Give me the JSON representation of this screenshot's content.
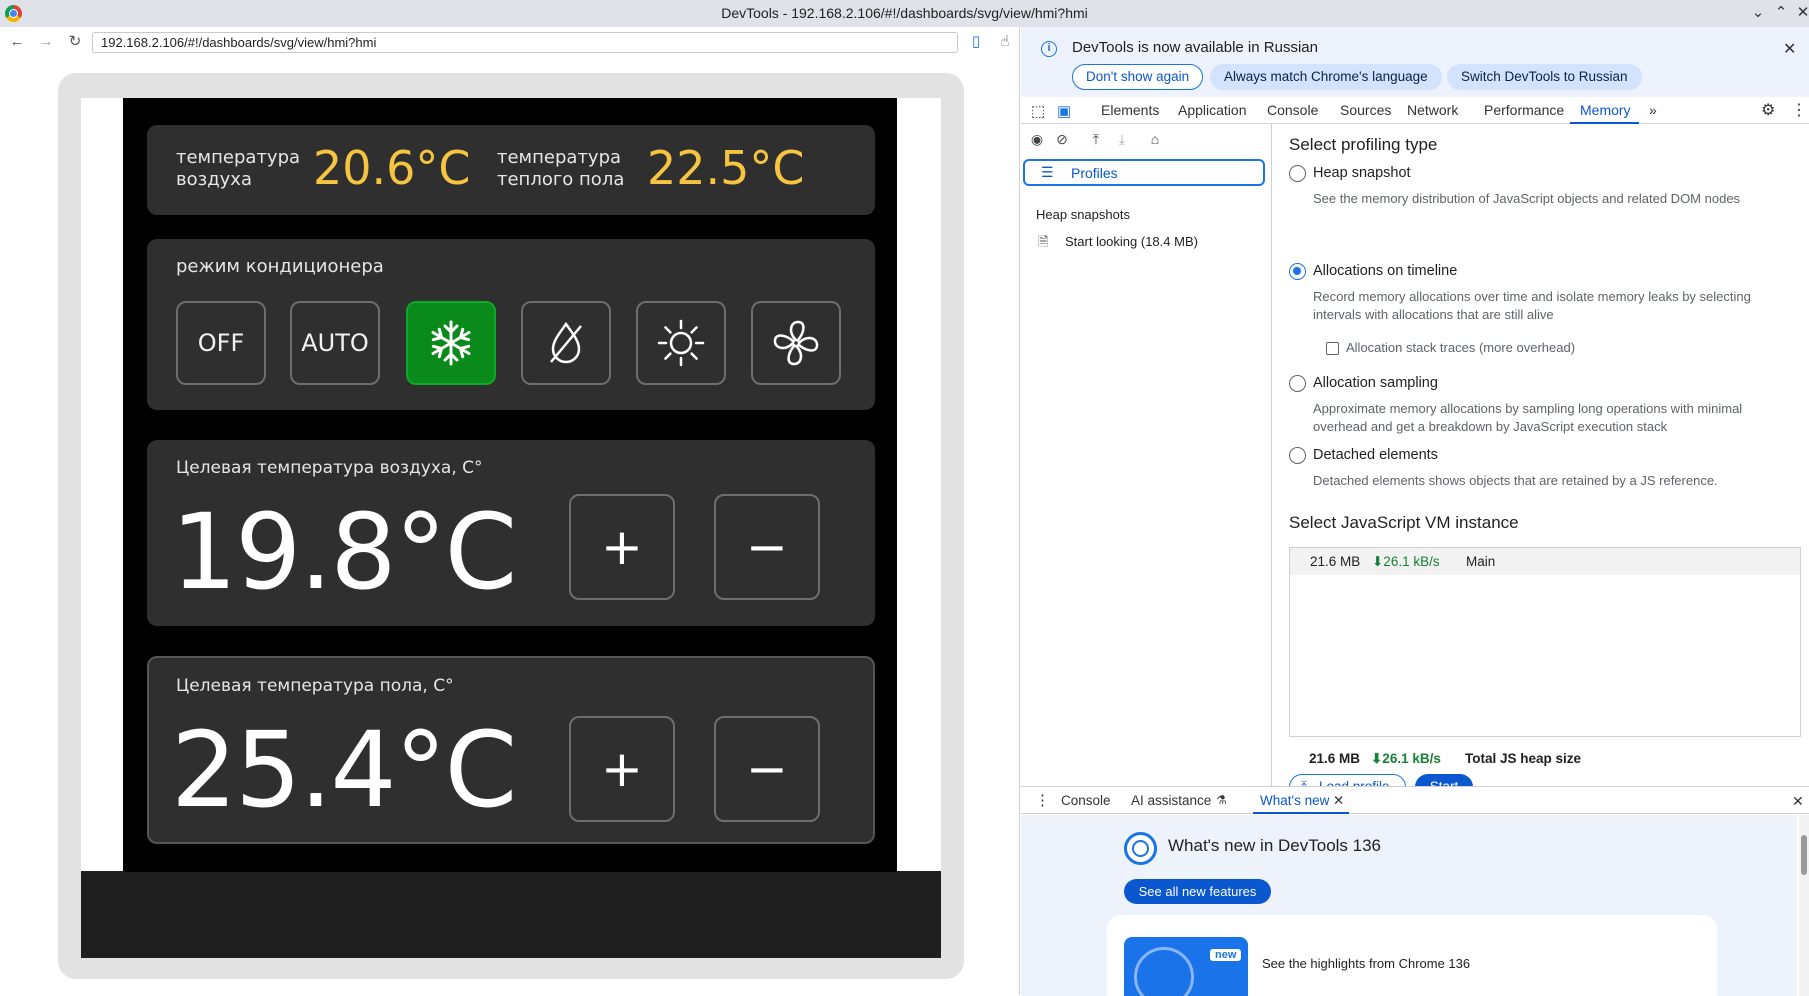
{
  "window": {
    "title": "DevTools - 192.168.2.106/#!/dashboards/svg/view/hmi?hmi"
  },
  "browser": {
    "url": "192.168.2.106/#!/dashboards/svg/view/hmi?hmi"
  },
  "hmi": {
    "air_temp_label_1": "температура",
    "air_temp_label_2": "воздуха",
    "air_temp_value": "20.6°C",
    "floor_temp_label_1": "температура",
    "floor_temp_label_2": "теплого пола",
    "floor_temp_value": "22.5°C",
    "ac_mode_title": "режим кондиционера",
    "modes": {
      "off": "OFF",
      "auto": "AUTO"
    },
    "active_mode": "cool",
    "target_air_title": "Целевая температура воздуха, C°",
    "target_air_value": "19.8°C",
    "target_floor_title": "Целевая температура пола, C°",
    "target_floor_value": "25.4°C",
    "plus": "+",
    "minus": "−"
  },
  "devtools": {
    "infobar": {
      "message": "DevTools is now available in Russian",
      "dont_show": "Don't show again",
      "match_lang": "Always match Chrome's language",
      "switch_lang": "Switch DevTools to Russian"
    },
    "tabs": [
      "Elements",
      "Application",
      "Console",
      "Sources",
      "Network",
      "Performance",
      "Memory"
    ],
    "active_tab": "Memory",
    "sidebar": {
      "profiles": "Profiles",
      "heap_snapshots_heading": "Heap snapshots",
      "snapshot_item": "Start looking (18.4 MB)"
    },
    "profiling": {
      "title": "Select profiling type",
      "options": [
        {
          "label": "Heap snapshot",
          "desc": "See the memory distribution of JavaScript objects and related DOM nodes",
          "selected": false
        },
        {
          "label": "Allocations on timeline",
          "desc": "Record memory allocations over time and isolate memory leaks by selecting intervals with allocations that are still alive",
          "selected": true
        },
        {
          "label": "Allocation sampling",
          "desc": "Approximate memory allocations by sampling long operations with minimal overhead and get a breakdown by JavaScript execution stack",
          "selected": false
        },
        {
          "label": "Detached elements",
          "desc": "Detached elements shows objects that are retained by a JS reference.",
          "selected": false
        }
      ],
      "stack_traces_checkbox": "Allocation stack traces (more overhead)"
    },
    "vm": {
      "title": "Select JavaScript VM instance",
      "size": "21.6 MB",
      "rate": "⬇26.1 kB/s",
      "name": "Main",
      "total_size": "21.6 MB",
      "total_rate": "⬇26.1 kB/s",
      "total_label": "Total JS heap size"
    },
    "buttons": {
      "load_profile": "Load profile",
      "start": "Start"
    },
    "drawer": {
      "tabs": [
        "Console",
        "AI assistance",
        "What's new"
      ],
      "heading": "What's new in DevTools 136",
      "see_all": "See all new features",
      "badge": "new",
      "highlights": "See the highlights from Chrome 136"
    }
  },
  "colors": {
    "accent": "#0b57d0",
    "active_mode": "#0a8a1a",
    "temp_yellow": "#f5c542"
  }
}
